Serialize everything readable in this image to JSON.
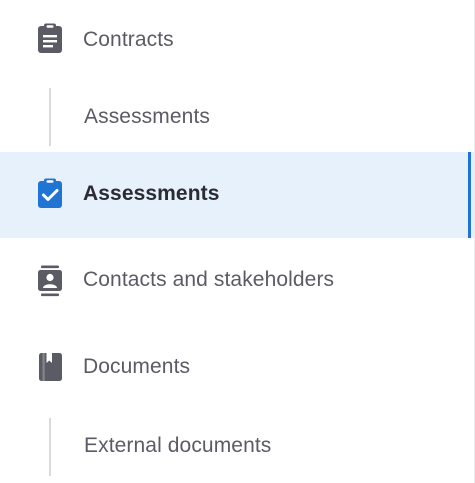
{
  "nav": {
    "items": [
      {
        "label": "Contracts",
        "icon": "clipboard-list-icon"
      },
      {
        "label": "Assessments",
        "sub": true
      },
      {
        "label": "Assessments",
        "icon": "clipboard-check-icon",
        "active": true
      },
      {
        "label": "Contacts and stakeholders",
        "icon": "contact-card-icon"
      },
      {
        "label": "Documents",
        "icon": "book-icon"
      },
      {
        "label": "External documents",
        "sub": true
      }
    ]
  },
  "colors": {
    "icon": "#5b5b66",
    "active_icon": "#1f74d4",
    "active_background": "#e7f1fb",
    "active_marker": "#1f74d4"
  }
}
